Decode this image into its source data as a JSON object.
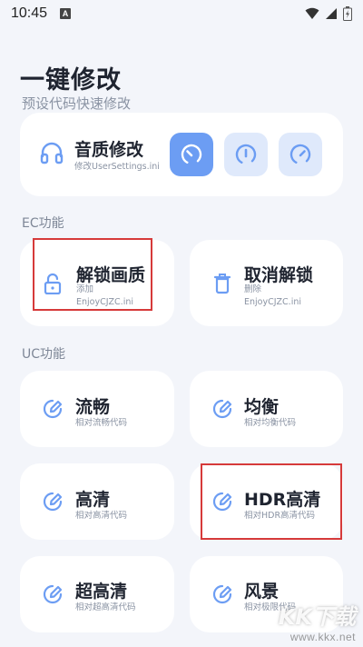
{
  "status_bar": {
    "time": "10:45",
    "notification_icon": "a-letter-icon",
    "icons": [
      "wifi-icon",
      "signal-icon",
      "battery-charging-icon"
    ]
  },
  "header": {
    "title": "一键修改",
    "subtitle": "预设代码快速修改"
  },
  "quality_card": {
    "title": "音质修改",
    "subtitle": "修改UserSettings.ini",
    "icon": "headphones-icon",
    "buttons": [
      "gauge-low-icon",
      "gauge-mid-icon",
      "gauge-high-icon"
    ],
    "active_index": 0
  },
  "ec_section": {
    "label": "EC功能",
    "cards": [
      {
        "title": "解锁画质",
        "sub1": "添加",
        "sub2": "EnjoyCJZC.ini",
        "icon": "lock-icon"
      },
      {
        "title": "取消解锁",
        "sub1": "删除",
        "sub2": "EnjoyCJZC.ini",
        "icon": "trash-icon"
      }
    ]
  },
  "uc_section": {
    "label": "UC功能",
    "cards": [
      {
        "title": "流畅",
        "sub": "相对流畅代码",
        "icon": "edit-icon"
      },
      {
        "title": "均衡",
        "sub": "相对均衡代码",
        "icon": "edit-icon"
      },
      {
        "title": "高清",
        "sub": "相对高清代码",
        "icon": "edit-icon"
      },
      {
        "title": "HDR高清",
        "sub": "相对HDR高清代码",
        "icon": "edit-icon"
      },
      {
        "title": "超高清",
        "sub": "相对超高清代码",
        "icon": "edit-icon"
      },
      {
        "title": "风景",
        "sub": "相对极限代码",
        "icon": "edit-icon"
      }
    ]
  },
  "watermark": {
    "logo": "KK下载",
    "url": "www.kkx.net"
  },
  "colors": {
    "accent": "#6c9df3",
    "accent_light": "#dfe9fb",
    "background": "#f3f5fa",
    "highlight": "#d63a3a"
  }
}
